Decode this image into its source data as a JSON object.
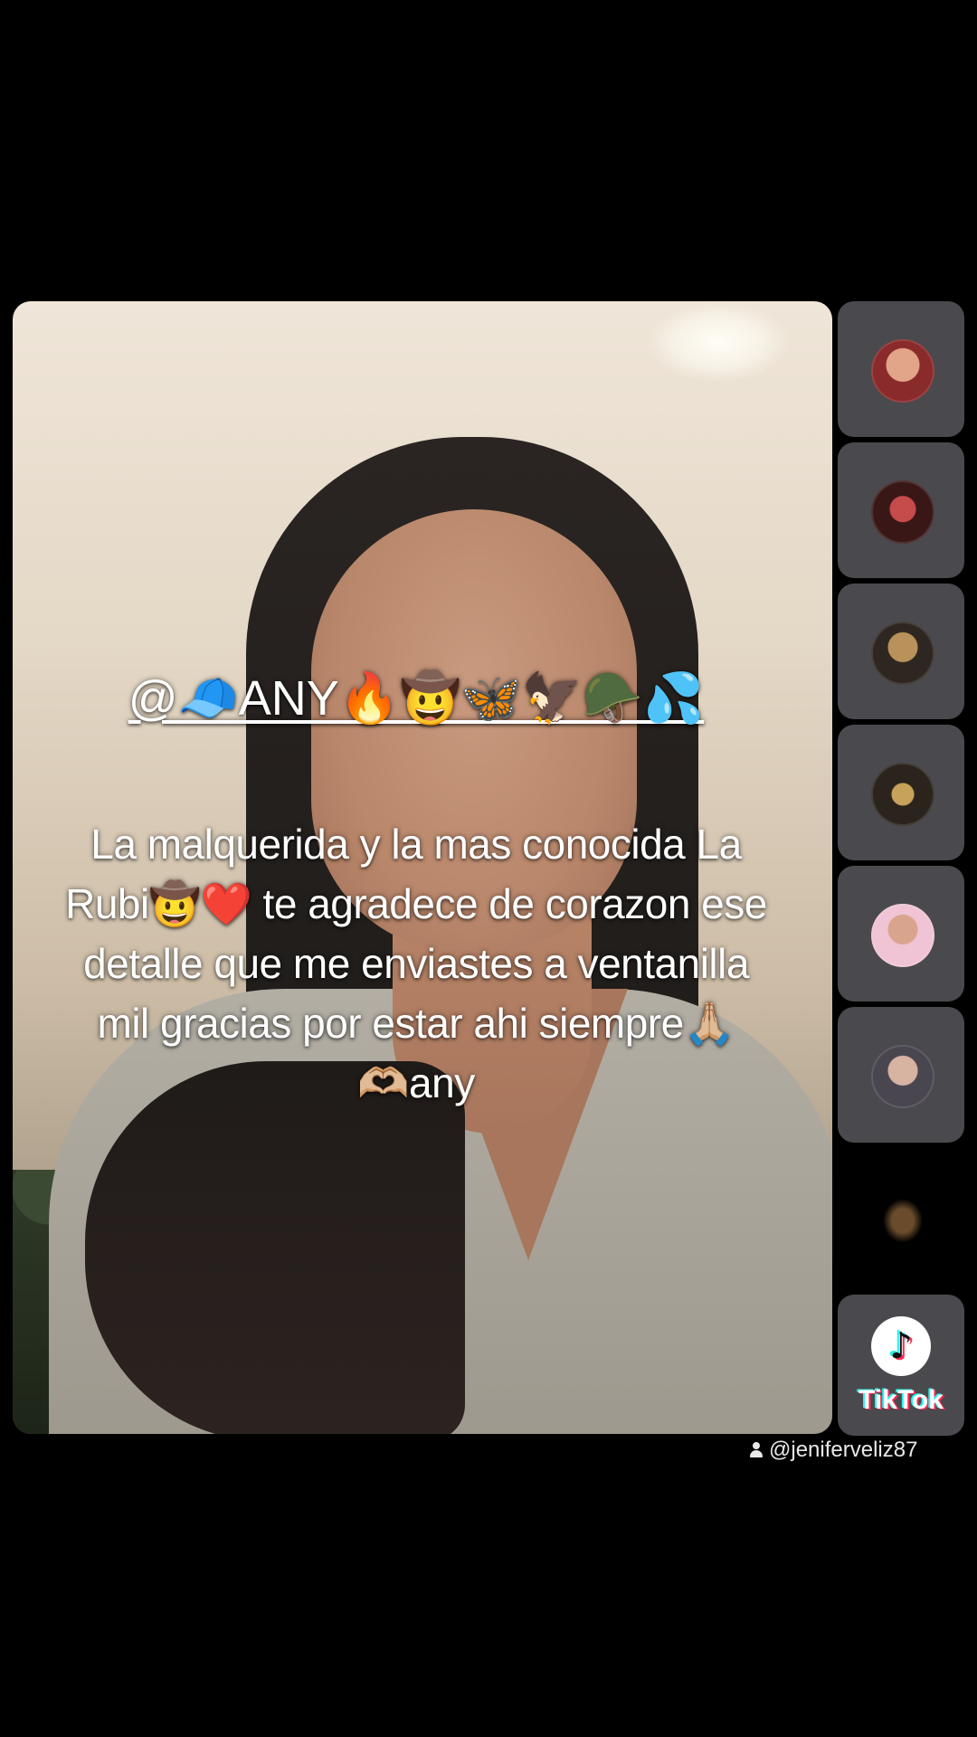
{
  "overlay": {
    "mention": "@🧢ANY🔥🤠🦋🦅🪖💦",
    "message_lines": [
      "La malquerida y la mas conocida La",
      "Rubi🤠❤️ te agradece de corazon ese",
      "detalle  que me enviastes a ventanilla",
      "mil gracias por estar ahi siempre🙏🏼",
      "🫶🏼any"
    ]
  },
  "sidebar": {
    "tiles": [
      {
        "avatar": "avatar-1",
        "color": "#8b2a2a"
      },
      {
        "avatar": "avatar-2",
        "color": "#5a2626"
      },
      {
        "avatar": "avatar-3",
        "color": "#4a3a2a"
      },
      {
        "avatar": "avatar-4",
        "color": "#3a3226"
      },
      {
        "avatar": "avatar-5",
        "color": "#e8b0c0"
      },
      {
        "avatar": "avatar-6",
        "color": "#6a6470"
      },
      {
        "avatar": "avatar-7",
        "color": "#2a241c"
      }
    ]
  },
  "watermark": {
    "brand": "TikTok",
    "note_glyph": "♪",
    "handle": "@jeniferveliz87"
  }
}
